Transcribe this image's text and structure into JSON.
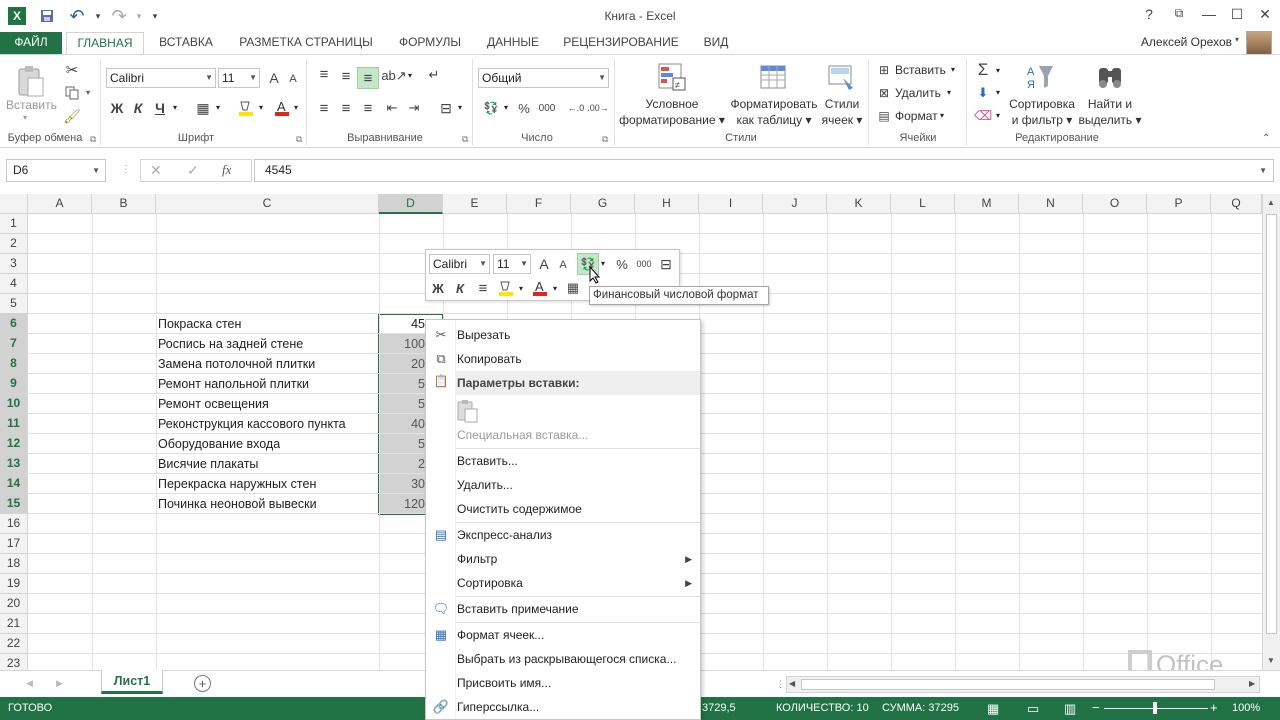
{
  "window": {
    "title": "Книга - Excel",
    "user": "Алексей Орехов",
    "help": "?",
    "controls": [
      "🗗",
      "—",
      "☐",
      "✕"
    ]
  },
  "qat": {
    "undo": "↶",
    "redo": "↷",
    "save": "💾",
    "more": "▾"
  },
  "tabs": [
    "ФАЙЛ",
    "ГЛАВНАЯ",
    "ВСТАВКА",
    "РАЗМЕТКА СТРАНИЦЫ",
    "ФОРМУЛЫ",
    "ДАННЫЕ",
    "РЕЦЕНЗИРОВАНИЕ",
    "ВИД"
  ],
  "ribbon": {
    "clipboard": {
      "paste": "Вставить",
      "label": "Буфер обмена"
    },
    "font": {
      "name": "Calibri",
      "size": "11",
      "bold": "Ж",
      "italic": "К",
      "underline": "Ч",
      "grow": "A",
      "shrink": "A",
      "label": "Шрифт"
    },
    "alignment": {
      "label": "Выравнивание"
    },
    "number": {
      "format": "Общий",
      "percent": "%",
      "thousands": "000",
      "label": "Число"
    },
    "styles": {
      "conditional": "Условное",
      "conditional2": "форматирование",
      "table": "Форматировать",
      "table2": "как таблицу",
      "cell": "Стили",
      "cell2": "ячеек",
      "label": "Стили"
    },
    "cells": {
      "insert": "Вставить",
      "delete": "Удалить",
      "format": "Формат",
      "label": "Ячейки"
    },
    "editing": {
      "sort": "Сортировка",
      "sort2": "и фильтр",
      "find": "Найти и",
      "find2": "выделить",
      "label": "Редактирование"
    }
  },
  "formula_bar": {
    "name_box": "D6",
    "fx": "fx",
    "value": "4545",
    "cancel": "✕",
    "enter": "✓"
  },
  "columns": [
    "A",
    "B",
    "C",
    "D",
    "E",
    "F",
    "G",
    "H",
    "I",
    "J",
    "K",
    "L",
    "M",
    "N",
    "O",
    "P",
    "Q"
  ],
  "rows": [
    "1",
    "2",
    "3",
    "4",
    "5",
    "6",
    "7",
    "8",
    "9",
    "10",
    "11",
    "12",
    "13",
    "14",
    "15",
    "16",
    "17",
    "18",
    "19",
    "20",
    "21",
    "22",
    "23"
  ],
  "cells_c": [
    "Покраска стен",
    "Роспись на задней стене",
    "Замена потолочной плитки",
    "Ремонт напольной плитки",
    "Ремонт освещения",
    "Реконструкция кассового пункта",
    "Оборудование входа",
    "Висячие плакаты",
    "Перекраска наружных стен",
    "Починка неоновой вывески"
  ],
  "cells_d": [
    "45",
    "100",
    "20",
    "5",
    "5",
    "40",
    "5",
    "2",
    "30",
    "120"
  ],
  "mini_toolbar": {
    "font": "Calibri",
    "size": "11",
    "percent": "%",
    "thousands": "000",
    "bold": "Ж",
    "italic": "К",
    "grow": "A",
    "shrink": "A"
  },
  "tooltip": "Финансовый числовой формат",
  "context_menu": [
    {
      "label": "Вырезать",
      "type": "item",
      "icon": "scissors-icon"
    },
    {
      "label": "Копировать",
      "type": "item",
      "icon": "copy-icon"
    },
    {
      "label": "Параметры вставки:",
      "type": "header",
      "icon": "paste-icon"
    },
    {
      "label": "",
      "type": "paste-option"
    },
    {
      "label": "Специальная вставка...",
      "type": "disabled"
    },
    {
      "label": "Вставить...",
      "type": "item"
    },
    {
      "label": "Удалить...",
      "type": "item"
    },
    {
      "label": "Очистить содержимое",
      "type": "item"
    },
    {
      "label": "Экспресс-анализ",
      "type": "item",
      "icon": "quick-analysis-icon"
    },
    {
      "label": "Фильтр",
      "type": "submenu"
    },
    {
      "label": "Сортировка",
      "type": "submenu"
    },
    {
      "label": "Вставить примечание",
      "type": "item",
      "icon": "comment-icon"
    },
    {
      "label": "Формат ячеек...",
      "type": "item",
      "icon": "format-cells-icon"
    },
    {
      "label": "Выбрать из раскрывающегося списка...",
      "type": "item"
    },
    {
      "label": "Присвоить имя...",
      "type": "item"
    },
    {
      "label": "Гиперссылка...",
      "type": "item",
      "icon": "hyperlink-icon"
    }
  ],
  "sheet": {
    "tab": "Лист1",
    "add": "+"
  },
  "status": {
    "ready": "ГОТОВО",
    "average": "3729,5",
    "count": "КОЛИЧЕСТВО: 10",
    "sum": "СУММА: 37295",
    "zoom": "100%"
  },
  "watermark": "Office",
  "colors": {
    "accent": "#217346",
    "selection": "#d2d2d2"
  }
}
